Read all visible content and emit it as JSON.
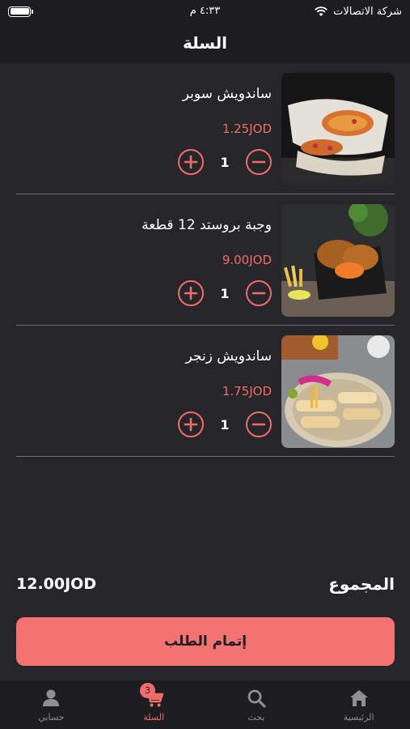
{
  "status_bar": {
    "carrier": "شركة الاتصالات",
    "time": "٤:٣٣ م"
  },
  "header": {
    "title": "السلة"
  },
  "cart": {
    "items": [
      {
        "name": "ساندويش سوبر",
        "price": "1.25JOD",
        "quantity": "1"
      },
      {
        "name": "وجبة بروستد 12 قطعة",
        "price": "9.00JOD",
        "quantity": "1"
      },
      {
        "name": "ساندويش زنجر",
        "price": "1.75JOD",
        "quantity": "1"
      }
    ]
  },
  "total": {
    "label": "المجموع",
    "value": "12.00JOD"
  },
  "checkout": {
    "label": "إتمام الطلب"
  },
  "tab_bar": {
    "home": "الرئيسية",
    "search": "بحث",
    "cart": "السلة",
    "cart_badge": "3",
    "account": "حسابي"
  },
  "colors": {
    "accent": "#f26b6b",
    "background": "#26262a",
    "bar_background": "#1d1d21"
  }
}
